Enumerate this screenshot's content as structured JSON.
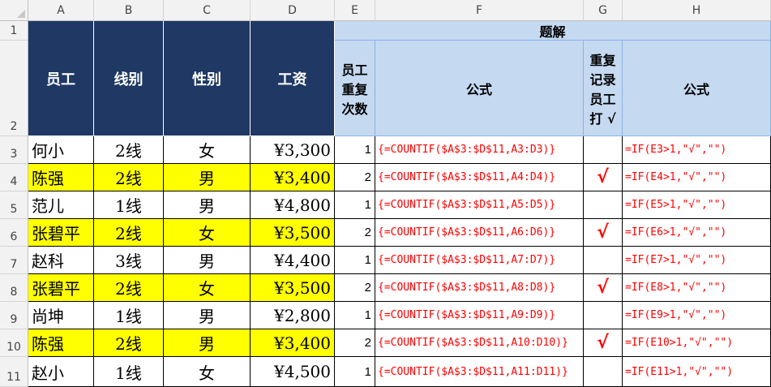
{
  "columns": [
    "A",
    "B",
    "C",
    "D",
    "E",
    "F",
    "G",
    "H"
  ],
  "rows": [
    "1",
    "2",
    "3",
    "4",
    "5",
    "6",
    "7",
    "8",
    "9",
    "10",
    "11"
  ],
  "headers": {
    "employee": "员工",
    "line": "线别",
    "gender": "性别",
    "salary": "工资",
    "solution": "题解",
    "repeat_count": "员工重复次数",
    "formula_f": "公式",
    "repeat_mark": "重复记录员工打 √",
    "formula_h": "公式"
  },
  "records": [
    {
      "name": "何小",
      "line": "2线",
      "gender": "女",
      "salary": "¥3,300",
      "count": "1",
      "f": "{=COUNTIF($A$3:$D$11,A3:D3)}",
      "mark": "",
      "h": "=IF(E3>1,\"√\",\"\")",
      "highlight": false
    },
    {
      "name": "陈强",
      "line": "2线",
      "gender": "男",
      "salary": "¥3,400",
      "count": "2",
      "f": "{=COUNTIF($A$3:$D$11,A4:D4)}",
      "mark": "√",
      "h": "=IF(E4>1,\"√\",\"\")",
      "highlight": true
    },
    {
      "name": "范儿",
      "line": "1线",
      "gender": "男",
      "salary": "¥4,800",
      "count": "1",
      "f": "{=COUNTIF($A$3:$D$11,A5:D5)}",
      "mark": "",
      "h": "=IF(E5>1,\"√\",\"\")",
      "highlight": false
    },
    {
      "name": "张碧平",
      "line": "2线",
      "gender": "女",
      "salary": "¥3,500",
      "count": "2",
      "f": "{=COUNTIF($A$3:$D$11,A6:D6)}",
      "mark": "√",
      "h": "=IF(E6>1,\"√\",\"\")",
      "highlight": true
    },
    {
      "name": "赵科",
      "line": "3线",
      "gender": "男",
      "salary": "¥4,400",
      "count": "1",
      "f": "{=COUNTIF($A$3:$D$11,A7:D7)}",
      "mark": "",
      "h": "=IF(E7>1,\"√\",\"\")",
      "highlight": false
    },
    {
      "name": "张碧平",
      "line": "2线",
      "gender": "女",
      "salary": "¥3,500",
      "count": "2",
      "f": "{=COUNTIF($A$3:$D$11,A8:D8)}",
      "mark": "√",
      "h": "=IF(E8>1,\"√\",\"\")",
      "highlight": true
    },
    {
      "name": "尚坤",
      "line": "1线",
      "gender": "男",
      "salary": "¥2,800",
      "count": "1",
      "f": "{=COUNTIF($A$3:$D$11,A9:D9)}",
      "mark": "",
      "h": "=IF(E9>1,\"√\",\"\")",
      "highlight": false
    },
    {
      "name": "陈强",
      "line": "2线",
      "gender": "男",
      "salary": "¥3,400",
      "count": "2",
      "f": "{=COUNTIF($A$3:$D$11,A10:D10)}",
      "mark": "√",
      "h": "=IF(E10>1,\"√\",\"\")",
      "highlight": true
    },
    {
      "name": "赵小",
      "line": "1线",
      "gender": "女",
      "salary": "¥4,500",
      "count": "1",
      "f": "{=COUNTIF($A$3:$D$11,A11:D11)}",
      "mark": "",
      "h": "=IF(E11>1,\"√\",\"\")",
      "highlight": false
    }
  ],
  "colors": {
    "header_navy": "#1f3864",
    "header_blue": "#c5d9f1",
    "highlight": "#ffff00",
    "formula": "#ff0000"
  }
}
